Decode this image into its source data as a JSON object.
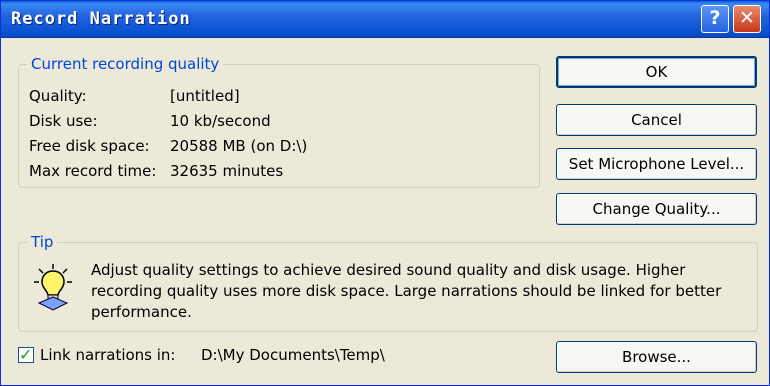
{
  "window": {
    "title": "Record Narration",
    "help_glyph": "?",
    "close_glyph": "✕"
  },
  "quality_group": {
    "label": "Current recording quality",
    "rows": [
      {
        "label": "Quality:",
        "value": "[untitled]"
      },
      {
        "label": "Disk use:",
        "value": "10 kb/second"
      },
      {
        "label": "Free disk space:",
        "value": "20588 MB (on D:\\)"
      },
      {
        "label": "Max record time:",
        "value": "32635 minutes"
      }
    ]
  },
  "buttons": {
    "ok": "OK",
    "cancel": "Cancel",
    "microphone": "Set Microphone Level...",
    "change_quality": "Change Quality...",
    "browse": "Browse..."
  },
  "tip_group": {
    "label": "Tip",
    "text": "Adjust quality settings to achieve desired sound quality and disk usage. Higher recording quality uses more disk space. Large narrations should be linked for better performance.",
    "icon": "lightbulb-icon"
  },
  "link": {
    "checked": true,
    "label": "Link narrations in:",
    "path": "D:\\My Documents\\Temp\\"
  },
  "colors": {
    "titlebar": "#0a5fdb",
    "group_label": "#0046d5",
    "dialog_bg": "#ece9d8"
  }
}
